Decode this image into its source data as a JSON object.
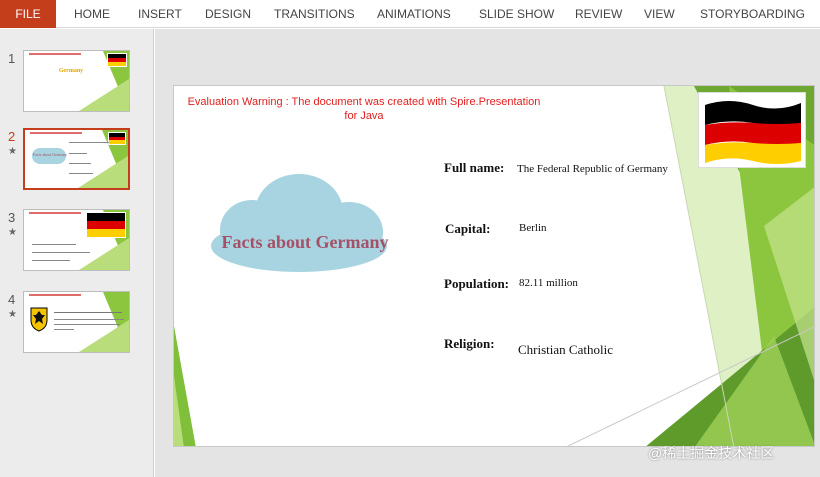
{
  "ribbon": {
    "tabs": [
      "FILE",
      "HOME",
      "INSERT",
      "DESIGN",
      "TRANSITIONS",
      "ANIMATIONS",
      "SLIDE SHOW",
      "REVIEW",
      "VIEW",
      "STORYBOARDING"
    ]
  },
  "thumbnails": [
    {
      "number": "1",
      "title": "Germany",
      "selected": false,
      "starred": false
    },
    {
      "number": "2",
      "title": "Facts about Germany",
      "selected": true,
      "starred": true
    },
    {
      "number": "3",
      "title": "",
      "selected": false,
      "starred": true
    },
    {
      "number": "4",
      "title": "",
      "selected": false,
      "starred": true
    }
  ],
  "star_glyph": "★",
  "slide": {
    "warning": "Evaluation Warning : The document was created with  Spire.Presentation for Java",
    "cloud_title": "Facts about Germany",
    "fields": [
      {
        "label": "Full name:",
        "value": "The Federal Republic of Germany"
      },
      {
        "label": "Capital:",
        "value": "Berlin"
      },
      {
        "label": "Population:",
        "value": "82.11 million"
      },
      {
        "label": "Religion:",
        "value": "Christian Catholic"
      }
    ]
  },
  "colors": {
    "file_tab": "#c43e1c",
    "warning_text": "#e32020",
    "cloud": "#a8d4e2",
    "cloud_text": "#a45167",
    "green_dark": "#5e9b2b",
    "green": "#8cc63f",
    "green_light": "#c6e48f",
    "flag_black": "#000000",
    "flag_red": "#dd0000",
    "flag_gold": "#ffce00"
  },
  "watermark": "@稀土掘金技术社区"
}
